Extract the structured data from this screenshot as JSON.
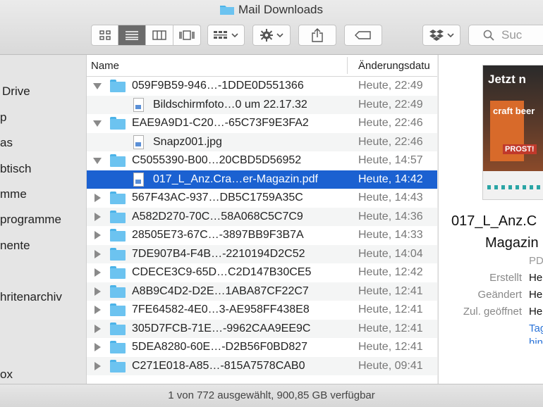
{
  "window": {
    "title": "Mail Downloads"
  },
  "toolbar": {
    "view_buttons": [
      "icon-view",
      "list-view",
      "column-view",
      "gallery-view"
    ],
    "search_placeholder": "Suc"
  },
  "sidebar": {
    "items": [
      {
        "label": "Drive",
        "top": 0
      },
      {
        "label": "p"
      },
      {
        "label": "as"
      },
      {
        "label": "btisch"
      },
      {
        "label": "mme"
      },
      {
        "label": "programme"
      },
      {
        "label": "nente"
      },
      {
        "label": "hritenarchiv"
      },
      {
        "label": "ox"
      }
    ]
  },
  "list": {
    "headers": {
      "name": "Name",
      "date": "Änderungsdatu"
    },
    "rows": [
      {
        "kind": "folder",
        "state": "open",
        "name": "059F9B59-946…-1DDE0D551366",
        "date": "Heute, 22:49"
      },
      {
        "kind": "file",
        "name": "Bildschirmfoto…0 um 22.17.32",
        "date": "Heute, 22:49"
      },
      {
        "kind": "folder",
        "state": "open",
        "name": "EAE9A9D1-C20…-65C73F9E3FA2",
        "date": "Heute, 22:46"
      },
      {
        "kind": "file",
        "name": "Snapz001.jpg",
        "date": "Heute, 22:46"
      },
      {
        "kind": "folder",
        "state": "open",
        "name": "C5055390-B00…20CBD5D56952",
        "date": "Heute, 14:57"
      },
      {
        "kind": "file",
        "selected": true,
        "name": "017_L_Anz.Cra…er-Magazin.pdf",
        "date": "Heute, 14:42"
      },
      {
        "kind": "folder",
        "state": "closed",
        "name": "567F43AC-937…DB5C1759A35C",
        "date": "Heute, 14:43"
      },
      {
        "kind": "folder",
        "state": "closed",
        "name": "A582D270-70C…58A068C5C7C9",
        "date": "Heute, 14:36"
      },
      {
        "kind": "folder",
        "state": "closed",
        "name": "28505E73-67C…-3897BB9F3B7A",
        "date": "Heute, 14:33"
      },
      {
        "kind": "folder",
        "state": "closed",
        "name": "7DE907B4-F4B…-2210194D2C52",
        "date": "Heute, 14:04"
      },
      {
        "kind": "folder",
        "state": "closed",
        "name": "CDECE3C9-65D…C2D147B30CE5",
        "date": "Heute, 12:42"
      },
      {
        "kind": "folder",
        "state": "closed",
        "name": "A8B9C4D2-D2E…1ABA87CF22C7",
        "date": "Heute, 12:41"
      },
      {
        "kind": "folder",
        "state": "closed",
        "name": "7FE64582-4E0…3-AE958FF438E8",
        "date": "Heute, 12:41"
      },
      {
        "kind": "folder",
        "state": "closed",
        "name": "305D7FCB-71E…-9962CAA9EE9C",
        "date": "Heute, 12:41"
      },
      {
        "kind": "folder",
        "state": "closed",
        "name": "5DEA8280-60E…-D2B56F0BD827",
        "date": "Heute, 12:41"
      },
      {
        "kind": "folder",
        "state": "closed",
        "name": "C271E018-A85…-815A7578CAB0",
        "date": "Heute, 09:41"
      }
    ]
  },
  "preview": {
    "thumbnail_text": {
      "headline": "Jetzt n",
      "brand": "craft beer",
      "stamp": "PROST!"
    },
    "name_line1": "017_L_Anz.C",
    "name_line2": "Magazin",
    "kind": "PD",
    "meta": [
      {
        "key": "Erstellt",
        "value": "He"
      },
      {
        "key": "Geändert",
        "value": "He"
      },
      {
        "key": "Zul. geöffnet",
        "value": "He"
      }
    ],
    "links": [
      "Tag",
      "hin"
    ]
  },
  "status": {
    "text": "1 von 772 ausgewählt, 900,85 GB verfügbar"
  }
}
